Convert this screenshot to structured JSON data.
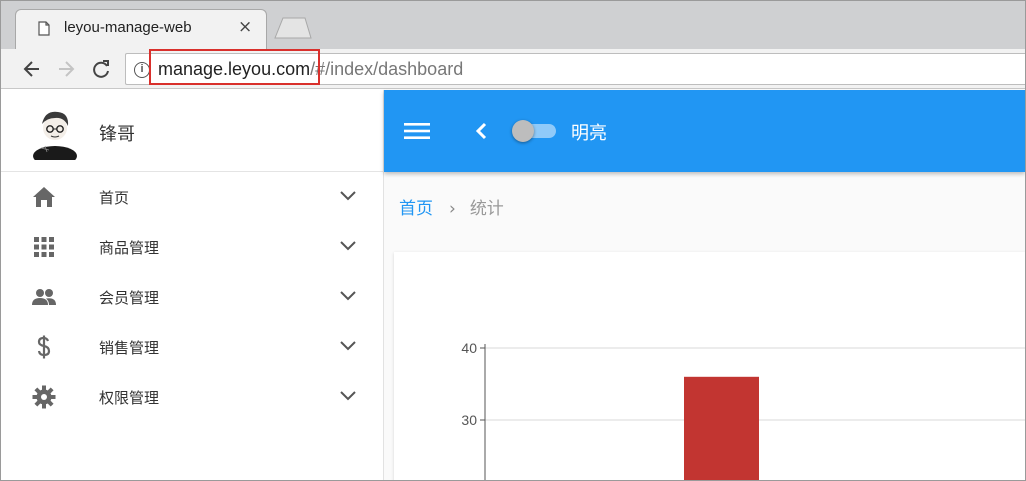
{
  "browser": {
    "tab_title": "leyou-manage-web",
    "tab_close": "×",
    "url_host": "manage.leyou.com",
    "url_path": "/#/index/dashboard"
  },
  "sidebar": {
    "username": "锋哥",
    "items": [
      {
        "label": "首页",
        "icon": "home-icon"
      },
      {
        "label": "商品管理",
        "icon": "apps-grid-icon"
      },
      {
        "label": "会员管理",
        "icon": "people-icon"
      },
      {
        "label": "销售管理",
        "icon": "dollar-icon"
      },
      {
        "label": "权限管理",
        "icon": "gear-icon"
      }
    ]
  },
  "topbar": {
    "toggle_label": "明亮",
    "accent": "#2196f3"
  },
  "breadcrumb": {
    "home": "首页",
    "separator": "›",
    "current": "统计"
  },
  "chart_data": {
    "type": "bar",
    "y_ticks": [
      40,
      30
    ],
    "series": [
      {
        "values": [
          36
        ],
        "color": "#c23531"
      }
    ],
    "grid": true
  }
}
